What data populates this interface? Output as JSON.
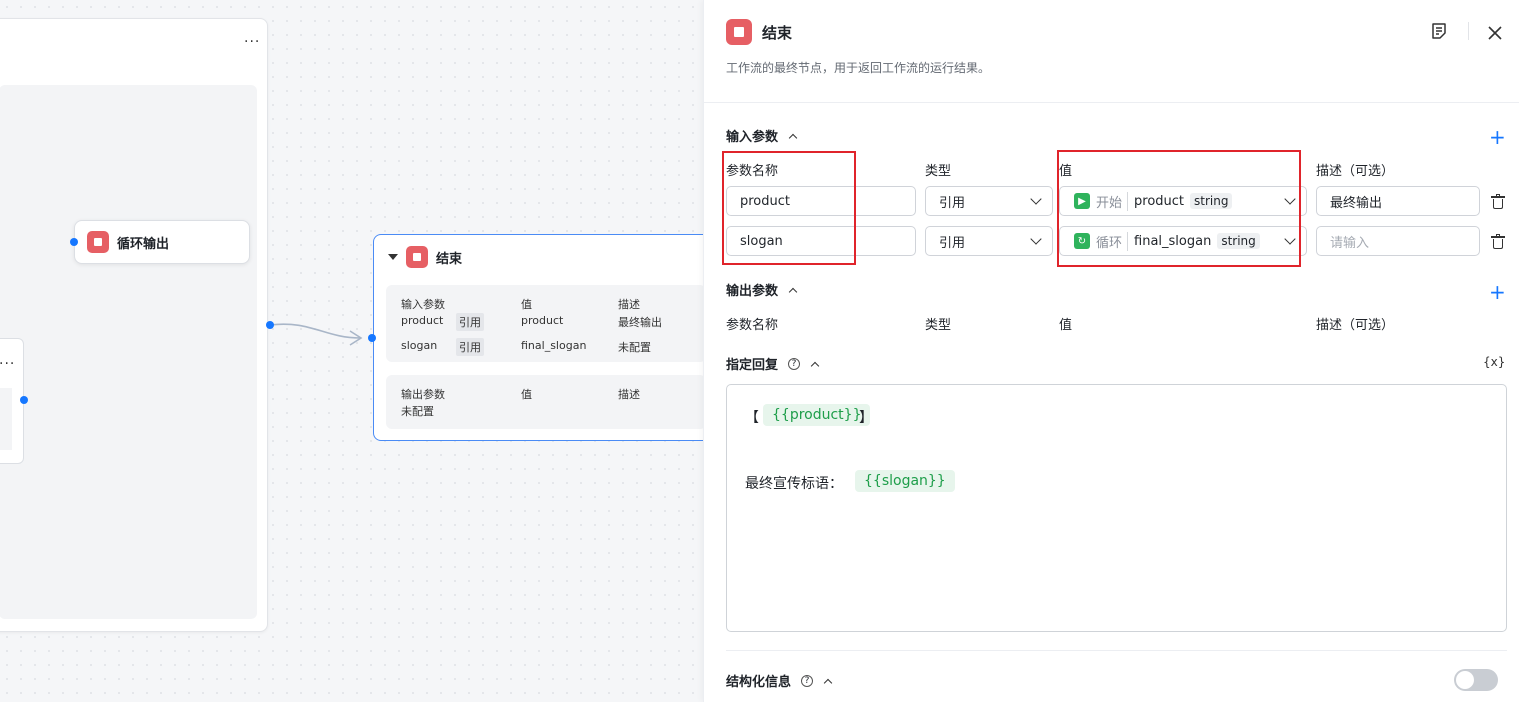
{
  "canvas": {
    "loop_node": {
      "menu": "..."
    },
    "loop_output_node": {
      "title": "循环输出"
    },
    "inner_node": {
      "menu": "..."
    },
    "end_node": {
      "title": "结束",
      "input_header": {
        "name": "输入参数",
        "value": "值",
        "desc": "描述"
      },
      "inputs": [
        {
          "name": "product",
          "tag": "引用",
          "value": "product",
          "desc": "最终输出"
        },
        {
          "name": "slogan",
          "tag": "引用",
          "value": "final_slogan",
          "desc": "未配置"
        }
      ],
      "output_header": {
        "name": "输出参数",
        "value": "值",
        "desc": "描述"
      },
      "output_status": "未配置"
    }
  },
  "panel": {
    "title": "结束",
    "description": "工作流的最终节点，用于返回工作流的运行结果。",
    "input_section": {
      "title": "输入参数",
      "columns": {
        "name": "参数名称",
        "type": "类型",
        "value": "值",
        "desc": "描述（可选）"
      },
      "rows": [
        {
          "name": "product",
          "type": "引用",
          "source": "开始",
          "var": "product",
          "var_type": "string",
          "desc": "最终输出",
          "desc_placeholder": ""
        },
        {
          "name": "slogan",
          "type": "引用",
          "source": "循环",
          "var": "final_slogan",
          "var_type": "string",
          "desc": "",
          "desc_placeholder": "请输入"
        }
      ]
    },
    "output_section": {
      "title": "输出参数",
      "columns": {
        "name": "参数名称",
        "type": "类型",
        "value": "值",
        "desc": "描述（可选）"
      }
    },
    "reply_section": {
      "title": "指定回复",
      "var_button": "{x}",
      "bracket_open": "【",
      "bracket_close": "】",
      "var1": "{{product}}",
      "line2_label": "最终宣传标语：",
      "var2": "{{slogan}}"
    },
    "structured_section": {
      "title": "结构化信息",
      "enabled": false
    }
  }
}
